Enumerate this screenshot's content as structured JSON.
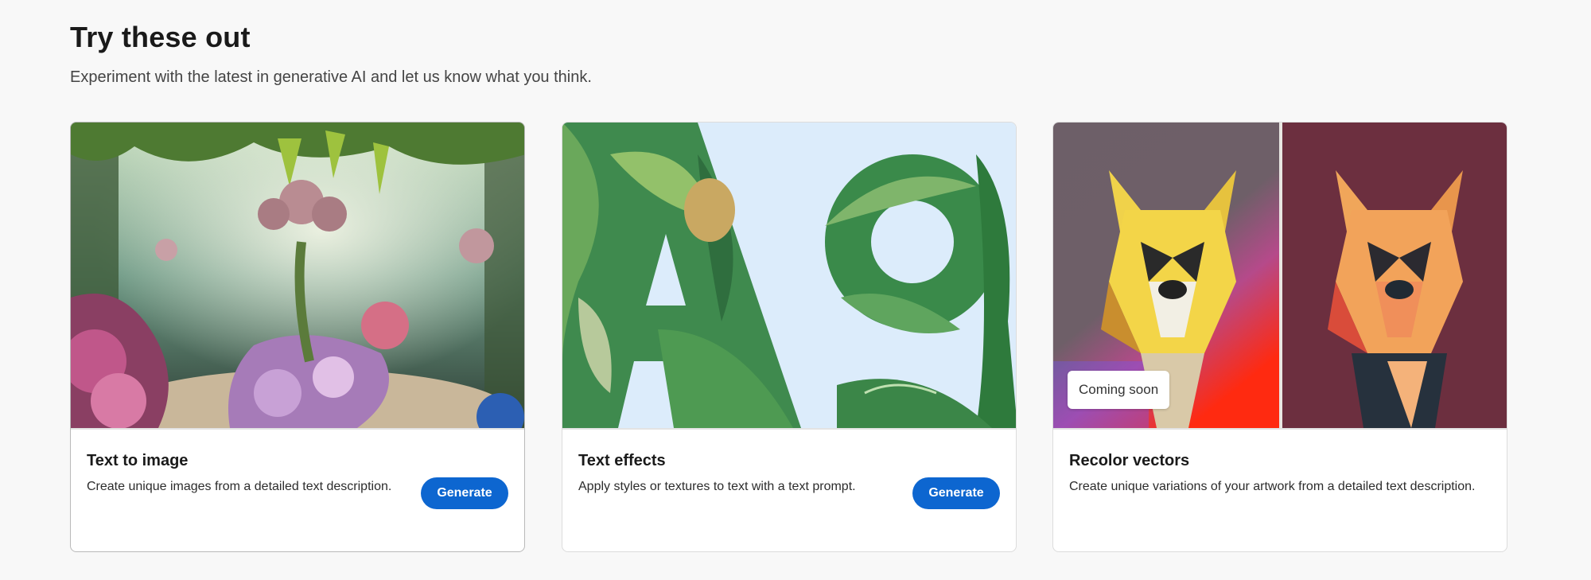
{
  "section": {
    "title": "Try these out",
    "subtitle": "Experiment with the latest in generative AI and let us know what you think."
  },
  "cards": [
    {
      "title": "Text to image",
      "description": "Create unique images from a detailed text description.",
      "button_label": "Generate"
    },
    {
      "title": "Text effects",
      "description": "Apply styles or textures to text with a text prompt.",
      "button_label": "Generate"
    },
    {
      "title": "Recolor vectors",
      "description": "Create unique variations of your artwork from a detailed text description.",
      "badge_label": "Coming soon"
    }
  ],
  "colors": {
    "primary_button": "#0d66d0",
    "page_background": "#f8f8f8"
  }
}
